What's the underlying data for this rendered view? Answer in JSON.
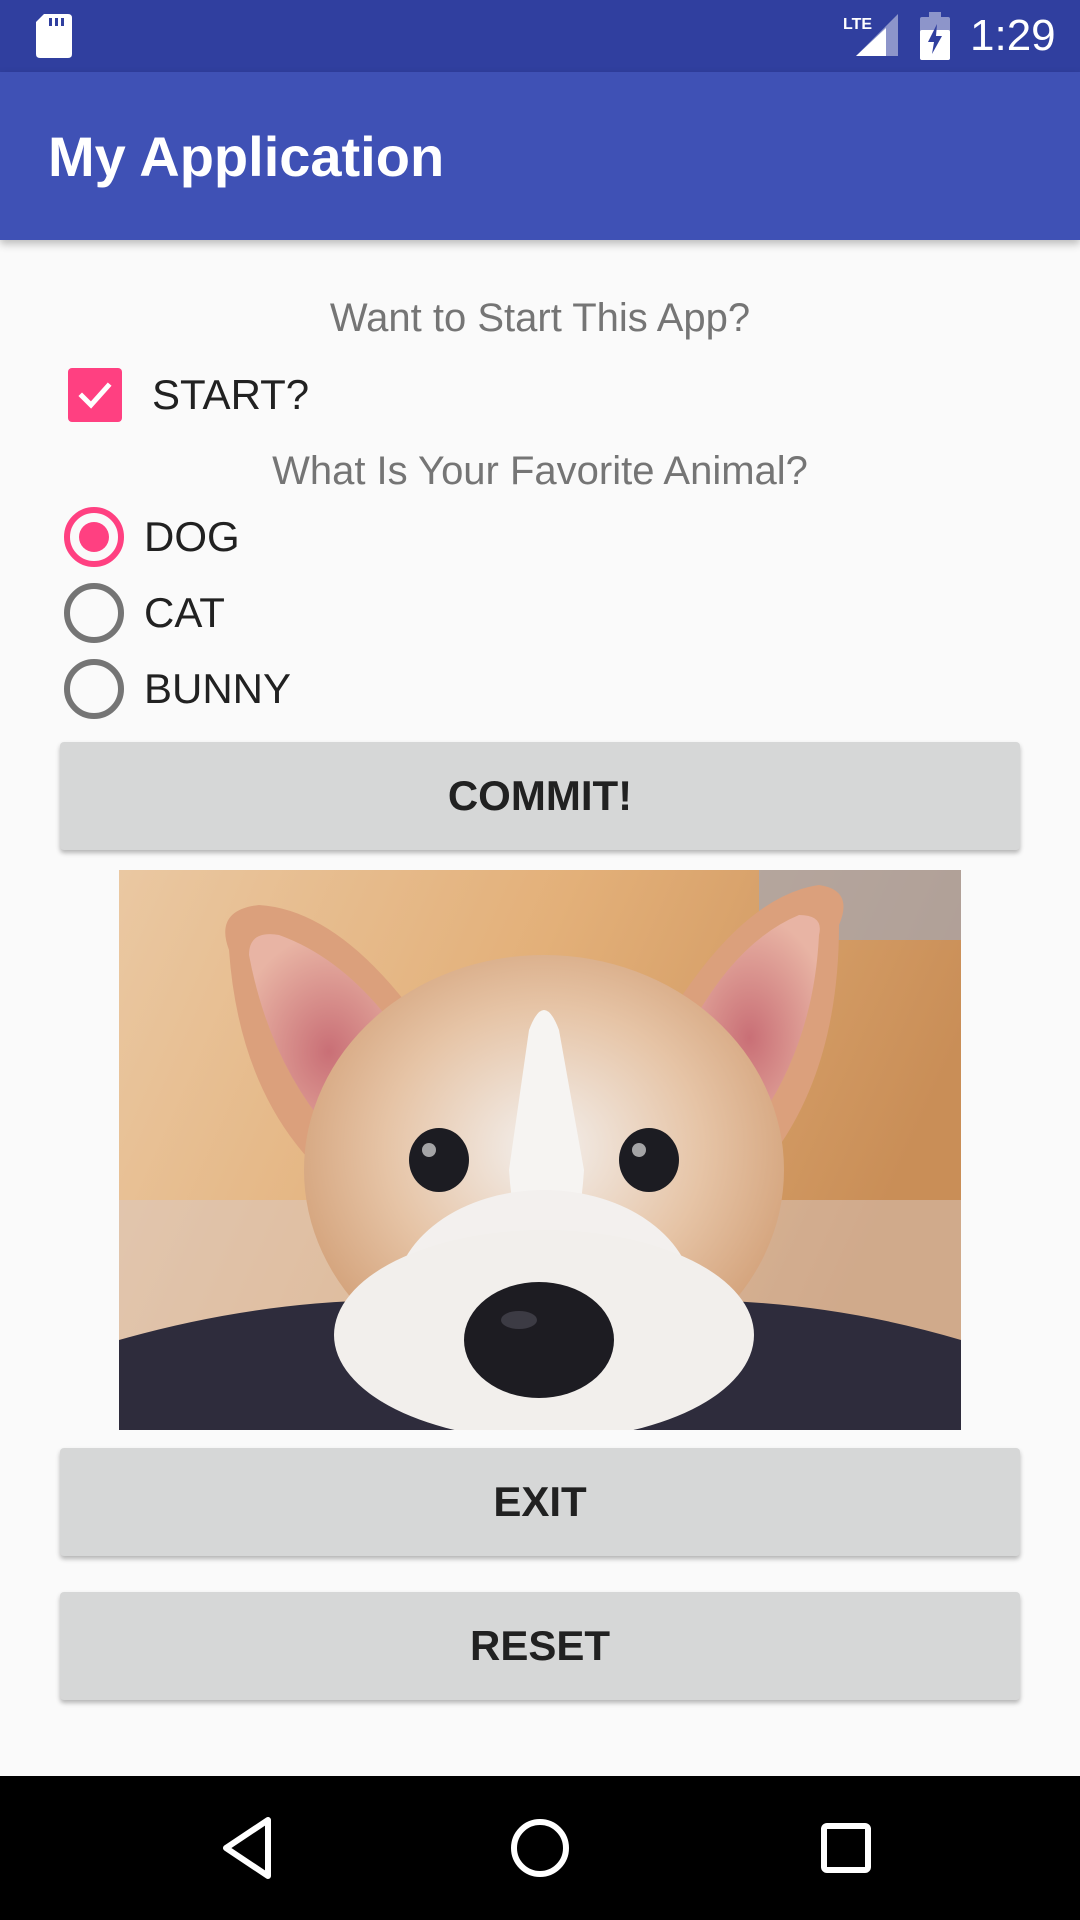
{
  "status_bar": {
    "time": "1:29",
    "network": "LTE",
    "icons": [
      "sd-card-icon",
      "lte-signal-icon",
      "battery-charging-icon"
    ]
  },
  "app_bar": {
    "title": "My Application"
  },
  "start_question": {
    "text": "Want to Start This App?"
  },
  "start_checkbox": {
    "label": "START?",
    "checked": true
  },
  "animal_question": {
    "text": "What Is Your Favorite Animal?"
  },
  "animal_options": [
    {
      "label": "DOG",
      "selected": true
    },
    {
      "label": "CAT",
      "selected": false
    },
    {
      "label": "BUNNY",
      "selected": false
    }
  ],
  "buttons": {
    "commit": "COMMIT!",
    "exit": "EXIT",
    "reset": "RESET"
  },
  "image": {
    "subject": "corgi dog photo"
  },
  "nav_bar": {
    "icons": [
      "back-icon",
      "home-icon",
      "recents-icon"
    ]
  },
  "colors": {
    "status_bar": "#303f9f",
    "app_bar": "#3f51b5",
    "accent": "#ff4081",
    "button": "#d6d7d7",
    "background": "#fafafa"
  }
}
